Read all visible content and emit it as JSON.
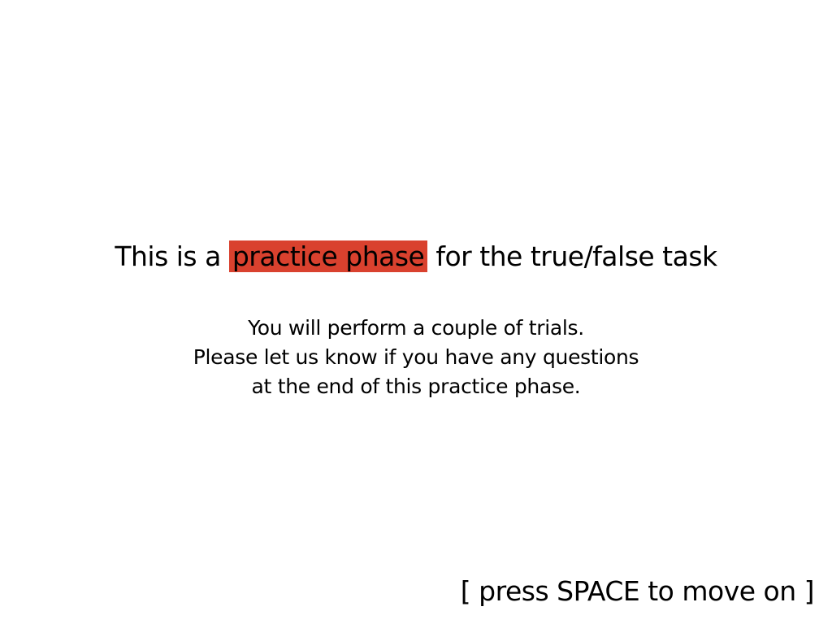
{
  "headline": {
    "before": "This is a ",
    "highlight": "practice phase",
    "after": " for the true/false task",
    "highlight_color": "#d9412e"
  },
  "instructions": {
    "lines": [
      "You will perform a couple of trials.",
      "Please let us know if you have any questions",
      "at the end of this practice phase."
    ]
  },
  "prompt": {
    "text": "[ press SPACE to move on ]"
  }
}
